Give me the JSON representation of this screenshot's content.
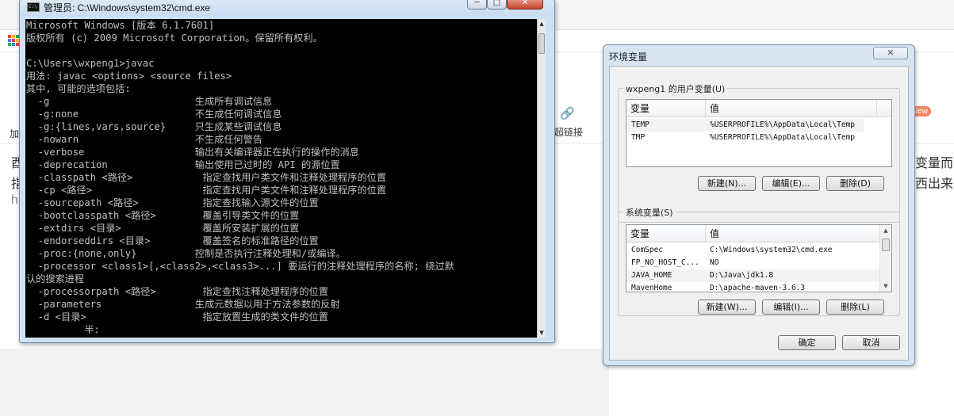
{
  "background": {
    "frag_plus": "加",
    "frag_link": "超链接",
    "frag_new": "New",
    "frag_right1": "变量而",
    "frag_right2": "西出来了",
    "frag_left1": "酉",
    "frag_left2": "指",
    "frag_left3": "h"
  },
  "cmd": {
    "title": "管理员: C:\\Windows\\system32\\cmd.exe",
    "icon_text": "C:\\",
    "minimize": "─",
    "maximize": "□",
    "close": "✕",
    "lines": [
      "Microsoft Windows [版本 6.1.7601]",
      "版权所有 (c) 2009 Microsoft Corporation。保留所有权利。",
      "",
      "C:\\Users\\wxpeng1>javac",
      "用法: javac <options> <source files>",
      "其中, 可能的选项包括:",
      "  -g                         生成所有调试信息",
      "  -g:none                    不生成任何调试信息",
      "  -g:{lines,vars,source}     只生成某些调试信息",
      "  -nowarn                    不生成任何警告",
      "  -verbose                   输出有关编译器正在执行的操作的消息",
      "  -deprecation               输出使用已过时的 API 的源位置",
      "  -classpath <路径>            指定查找用户类文件和注释处理程序的位置",
      "  -cp <路径>                   指定查找用户类文件和注释处理程序的位置",
      "  -sourcepath <路径>           指定查找输入源文件的位置",
      "  -bootclasspath <路径>        覆盖引导类文件的位置",
      "  -extdirs <目录>              覆盖所安装扩展的位置",
      "  -endorseddirs <目录>         覆盖签名的标准路径的位置",
      "  -proc:{none,only}          控制是否执行注释处理和/或编译。",
      "  -processor <class1>[,<class2>,<class3>...] 要运行的注释处理程序的名称; 绕过默",
      "认的搜索进程",
      "  -processorpath <路径>        指定查找注释处理程序的位置",
      "  -parameters                生成元数据以用于方法参数的反射",
      "  -d <目录>                    指定放置生成的类文件的位置",
      "          半:"
    ]
  },
  "env": {
    "title": "环境变量",
    "close": "✕",
    "user_group": "wxpeng1 的用户变量(U)",
    "col_var": "变量",
    "col_val": "值",
    "user_vars": [
      {
        "name": "TEMP",
        "value": "%USERPROFILE%\\AppData\\Local\\Temp"
      },
      {
        "name": "TMP",
        "value": "%USERPROFILE%\\AppData\\Local\\Temp"
      }
    ],
    "user_buttons": {
      "new": "新建(N)...",
      "edit": "编辑(E)...",
      "delete": "删除(D)"
    },
    "sys_group": "系统变量(S)",
    "sys_vars": [
      {
        "name": "ComSpec",
        "value": "C:\\Windows\\system32\\cmd.exe"
      },
      {
        "name": "FP_NO_HOST_C...",
        "value": "NO"
      },
      {
        "name": "JAVA_HOME",
        "value": "D:\\Java\\jdk1.8"
      },
      {
        "name": "MavenHome",
        "value": "D:\\apache-maven-3.6.3"
      }
    ],
    "sys_buttons": {
      "new": "新建(W)...",
      "edit": "编辑(I)...",
      "delete": "删除(L)"
    },
    "ok": "确定",
    "cancel": "取消"
  },
  "colors": {
    "console_bg": "#000000",
    "console_fg": "#c0c0c0",
    "dialog_frame": "#d9e4f1",
    "close_red": "#c7432c",
    "new_badge": "#f4845f"
  }
}
